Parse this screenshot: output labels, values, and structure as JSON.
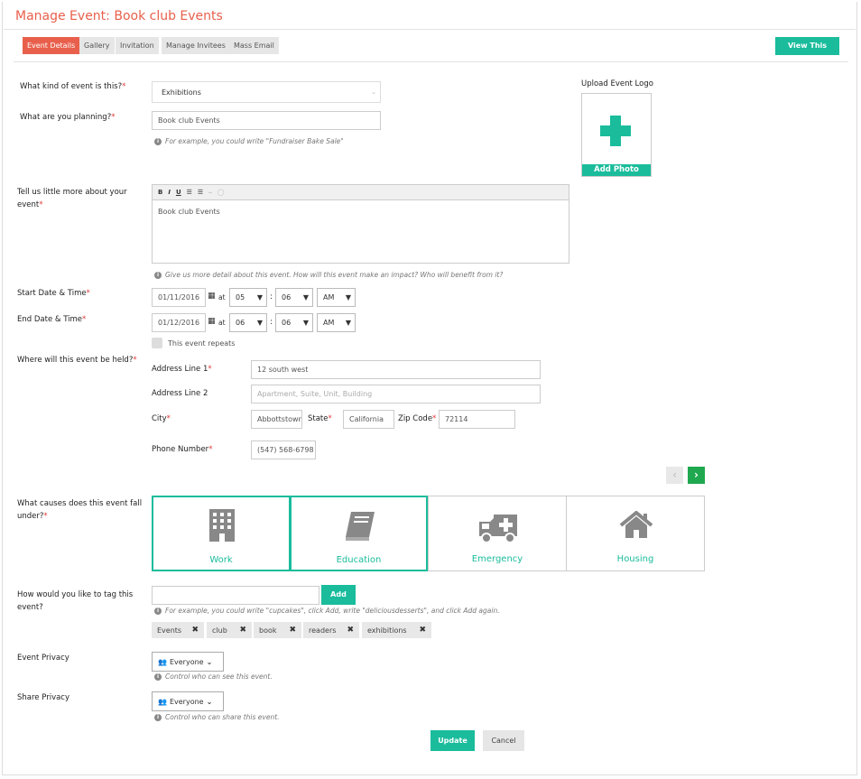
{
  "page_title": "Manage Event: Book club Events",
  "tabs": [
    "Event Details",
    "Gallery",
    "Invitation",
    "Manage Invitees",
    "Mass Email"
  ],
  "view_event_label": "View This Event",
  "event_kind": {
    "label": "What kind of event is this?",
    "value": "Exhibitions"
  },
  "planning": {
    "label": "What are you planning?",
    "value": "Book club Events",
    "hint": "For example, you could write \"Fundraiser Bake Sale\""
  },
  "logo": {
    "label": "Upload Event Logo",
    "add_photo": "Add Photo"
  },
  "description": {
    "label_line1": "Tell us little more about your",
    "label_line2": "event",
    "value": "Book club Events",
    "hint": "Give us more detail about this event. How will this event make an impact? Who will benefit from it?",
    "toolbar": [
      "B",
      "I",
      "U"
    ]
  },
  "start": {
    "label": "Start Date & Time",
    "date": "01/11/2016",
    "at": "at",
    "hour": "05",
    "minute": "06",
    "ampm": "AM"
  },
  "end": {
    "label": "End Date & Time",
    "date": "01/12/2016",
    "at": "at",
    "hour": "06",
    "minute": "06",
    "ampm": "AM"
  },
  "repeats_label": "This event repeats",
  "location": {
    "label": "Where will this event be held?",
    "addr1_label": "Address Line 1",
    "addr1_value": "12 south west",
    "addr2_label": "Address Line 2",
    "addr2_placeholder": "Apartment, Suite, Unit, Building",
    "city_label": "City",
    "city_value": "Abbottstown",
    "state_label": "State",
    "state_value": "California",
    "zip_label": "Zip Code",
    "zip_value": "72114",
    "phone_label": "Phone Number",
    "phone_value": "(547) 568-6798"
  },
  "causes": {
    "label_line1": "What causes does this event fall",
    "label_line2": "under?",
    "items": [
      "Work",
      "Education",
      "Emergency",
      "Housing"
    ]
  },
  "tags": {
    "label_line1": "How would you like to tag this",
    "label_line2": "event?",
    "add_label": "Add",
    "hint": "For example, you could write \"cupcakes\", click Add, write \"deliciousdesserts\", and click Add again.",
    "items": [
      "Events",
      "club",
      "book",
      "readers",
      "exhibitions"
    ]
  },
  "event_privacy": {
    "label": "Event Privacy",
    "value": "Everyone",
    "hint": "Control who can see this event."
  },
  "share_privacy": {
    "label": "Share Privacy",
    "value": "Everyone",
    "hint": "Control who can share this event."
  },
  "update_label": "Update",
  "cancel_label": "Cancel",
  "colors": {
    "accent": "#e8604c",
    "teal": "#1abc9c",
    "nav_green": "#1fa84f"
  }
}
